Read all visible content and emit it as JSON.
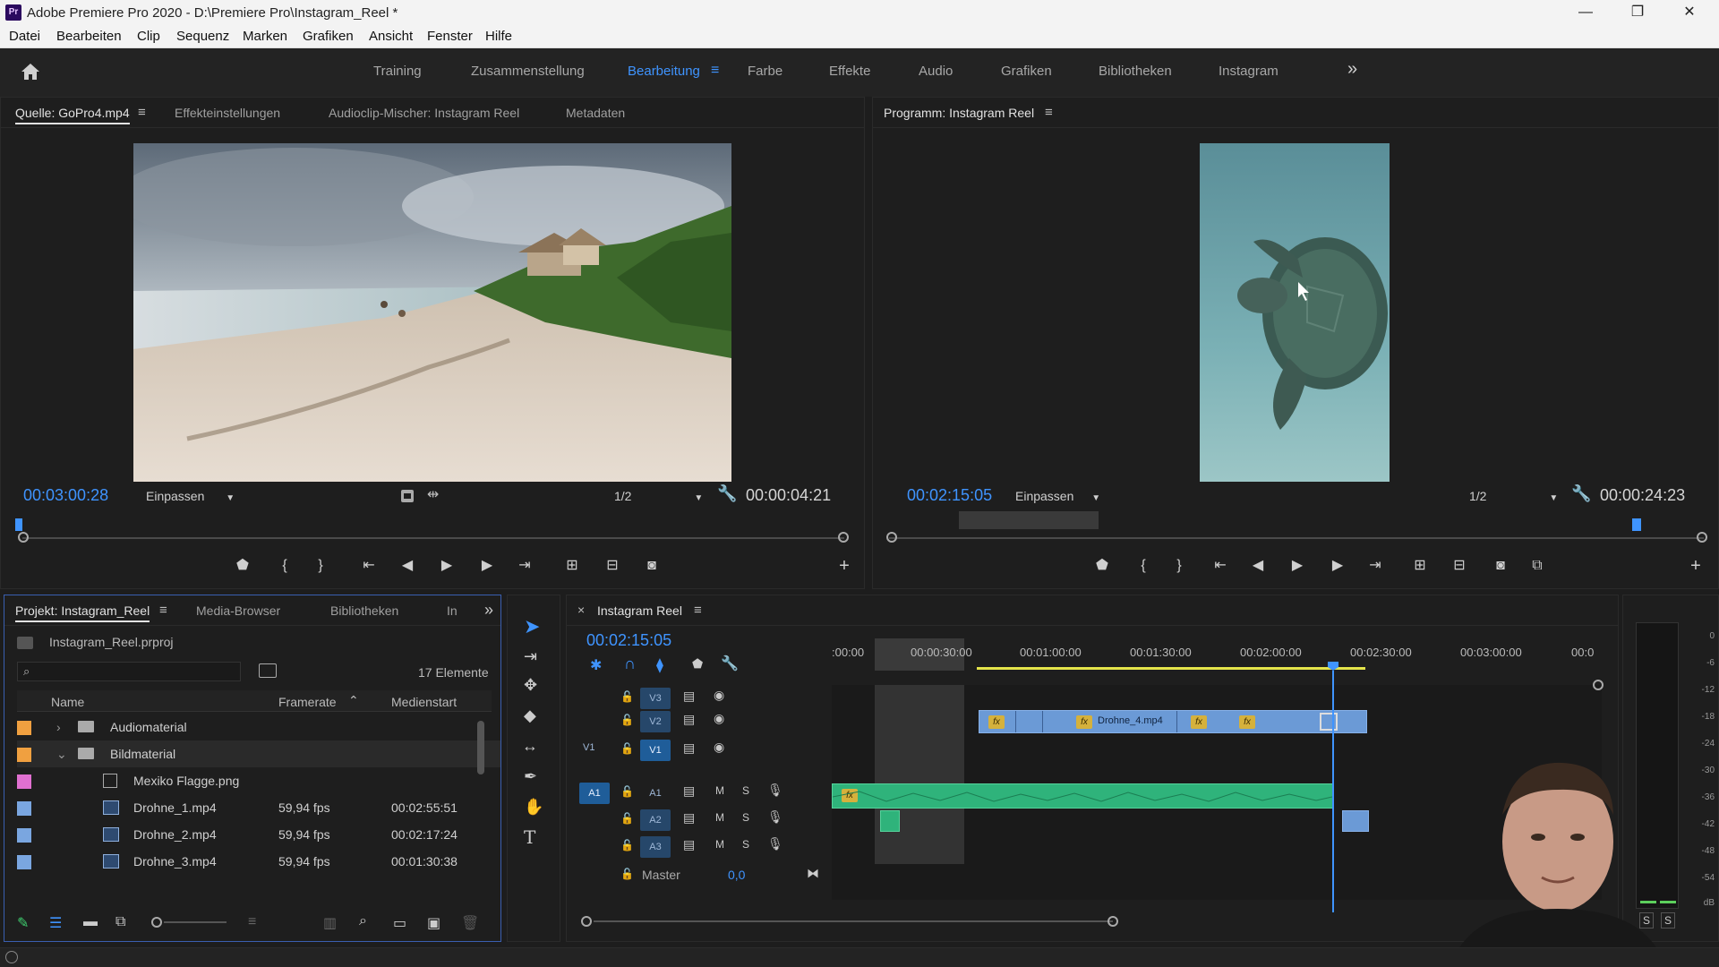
{
  "window": {
    "app_icon": "Pr",
    "title": "Adobe Premiere Pro 2020 - D:\\Premiere Pro\\Instagram_Reel *",
    "minimize": "—",
    "restore": "❐",
    "close": "✕"
  },
  "menu": [
    "Datei",
    "Bearbeiten",
    "Clip",
    "Sequenz",
    "Marken",
    "Grafiken",
    "Ansicht",
    "Fenster",
    "Hilfe"
  ],
  "workspaces": {
    "tabs": [
      "Training",
      "Zusammenstellung",
      "Bearbeitung",
      "Farbe",
      "Effekte",
      "Audio",
      "Grafiken",
      "Bibliotheken",
      "Instagram"
    ],
    "active": "Bearbeitung",
    "overflow": "»"
  },
  "source_panel": {
    "tabs": [
      "Quelle: GoPro4.mp4",
      "Effekteinstellungen",
      "Audioclip-Mischer: Instagram Reel",
      "Metadaten"
    ],
    "timecode": "00:03:00:28",
    "fit": "Einpassen",
    "resolution": "1/2",
    "duration": "00:00:04:21"
  },
  "program_panel": {
    "title": "Programm: Instagram Reel",
    "timecode": "00:02:15:05",
    "fit": "Einpassen",
    "resolution": "1/2",
    "duration": "00:00:24:23"
  },
  "project_panel": {
    "tabs": [
      "Projekt: Instagram_Reel",
      "Media-Browser",
      "Bibliotheken",
      "In"
    ],
    "file": "Instagram_Reel.prproj",
    "count": "17 Elemente",
    "search_placeholder": "",
    "columns": [
      "Name",
      "Framerate",
      "Medienstart"
    ],
    "rows": [
      {
        "name": "Audiomaterial",
        "framerate": "",
        "start": "",
        "type": "folder",
        "color": "#f0a040",
        "expand": "›",
        "indent": 0
      },
      {
        "name": "Bildmaterial",
        "framerate": "",
        "start": "",
        "type": "folder",
        "color": "#f0a040",
        "expand": "⌄",
        "indent": 0
      },
      {
        "name": "Mexiko Flagge.png",
        "framerate": "",
        "start": "",
        "type": "image",
        "color": "#e070d0",
        "expand": "",
        "indent": 1
      },
      {
        "name": "Drohne_1.mp4",
        "framerate": "59,94 fps",
        "start": "00:02:55:51",
        "type": "video",
        "color": "#7aa6e0",
        "expand": "",
        "indent": 1
      },
      {
        "name": "Drohne_2.mp4",
        "framerate": "59,94 fps",
        "start": "00:02:17:24",
        "type": "video",
        "color": "#7aa6e0",
        "expand": "",
        "indent": 1
      },
      {
        "name": "Drohne_3.mp4",
        "framerate": "59,94 fps",
        "start": "00:01:30:38",
        "type": "video",
        "color": "#7aa6e0",
        "expand": "",
        "indent": 1
      }
    ]
  },
  "timeline": {
    "close": "×",
    "title": "Instagram Reel",
    "timecode": "00:02:15:05",
    "ruler": [
      ":00:00",
      "00:00:30:00",
      "00:01:00:00",
      "00:01:30:00",
      "00:02:00:00",
      "00:02:30:00",
      "00:03:00:00",
      "00:0"
    ],
    "tracks": {
      "video": [
        "V3",
        "V2",
        "V1"
      ],
      "audio": [
        "A1",
        "A2",
        "A3"
      ],
      "source_v": "V1",
      "source_a": "A1",
      "mute": "M",
      "solo": "S"
    },
    "clip_label": "Drohne_4.mp4",
    "fx_label": "fx",
    "master_label": "Master",
    "master_value": "0,0"
  },
  "meter": {
    "labels": [
      "0",
      "-6",
      "-12",
      "-18",
      "-24",
      "-30",
      "-36",
      "-42",
      "-48",
      "-54",
      "dB"
    ],
    "solo_left": "S",
    "solo_right": "S"
  },
  "colors": {
    "accent": "#3f94ff",
    "video_clip": "#6b9ad6",
    "audio_clip": "#2fb37b",
    "playhead": "#3f94ff",
    "work_area": "#e4e44a"
  }
}
